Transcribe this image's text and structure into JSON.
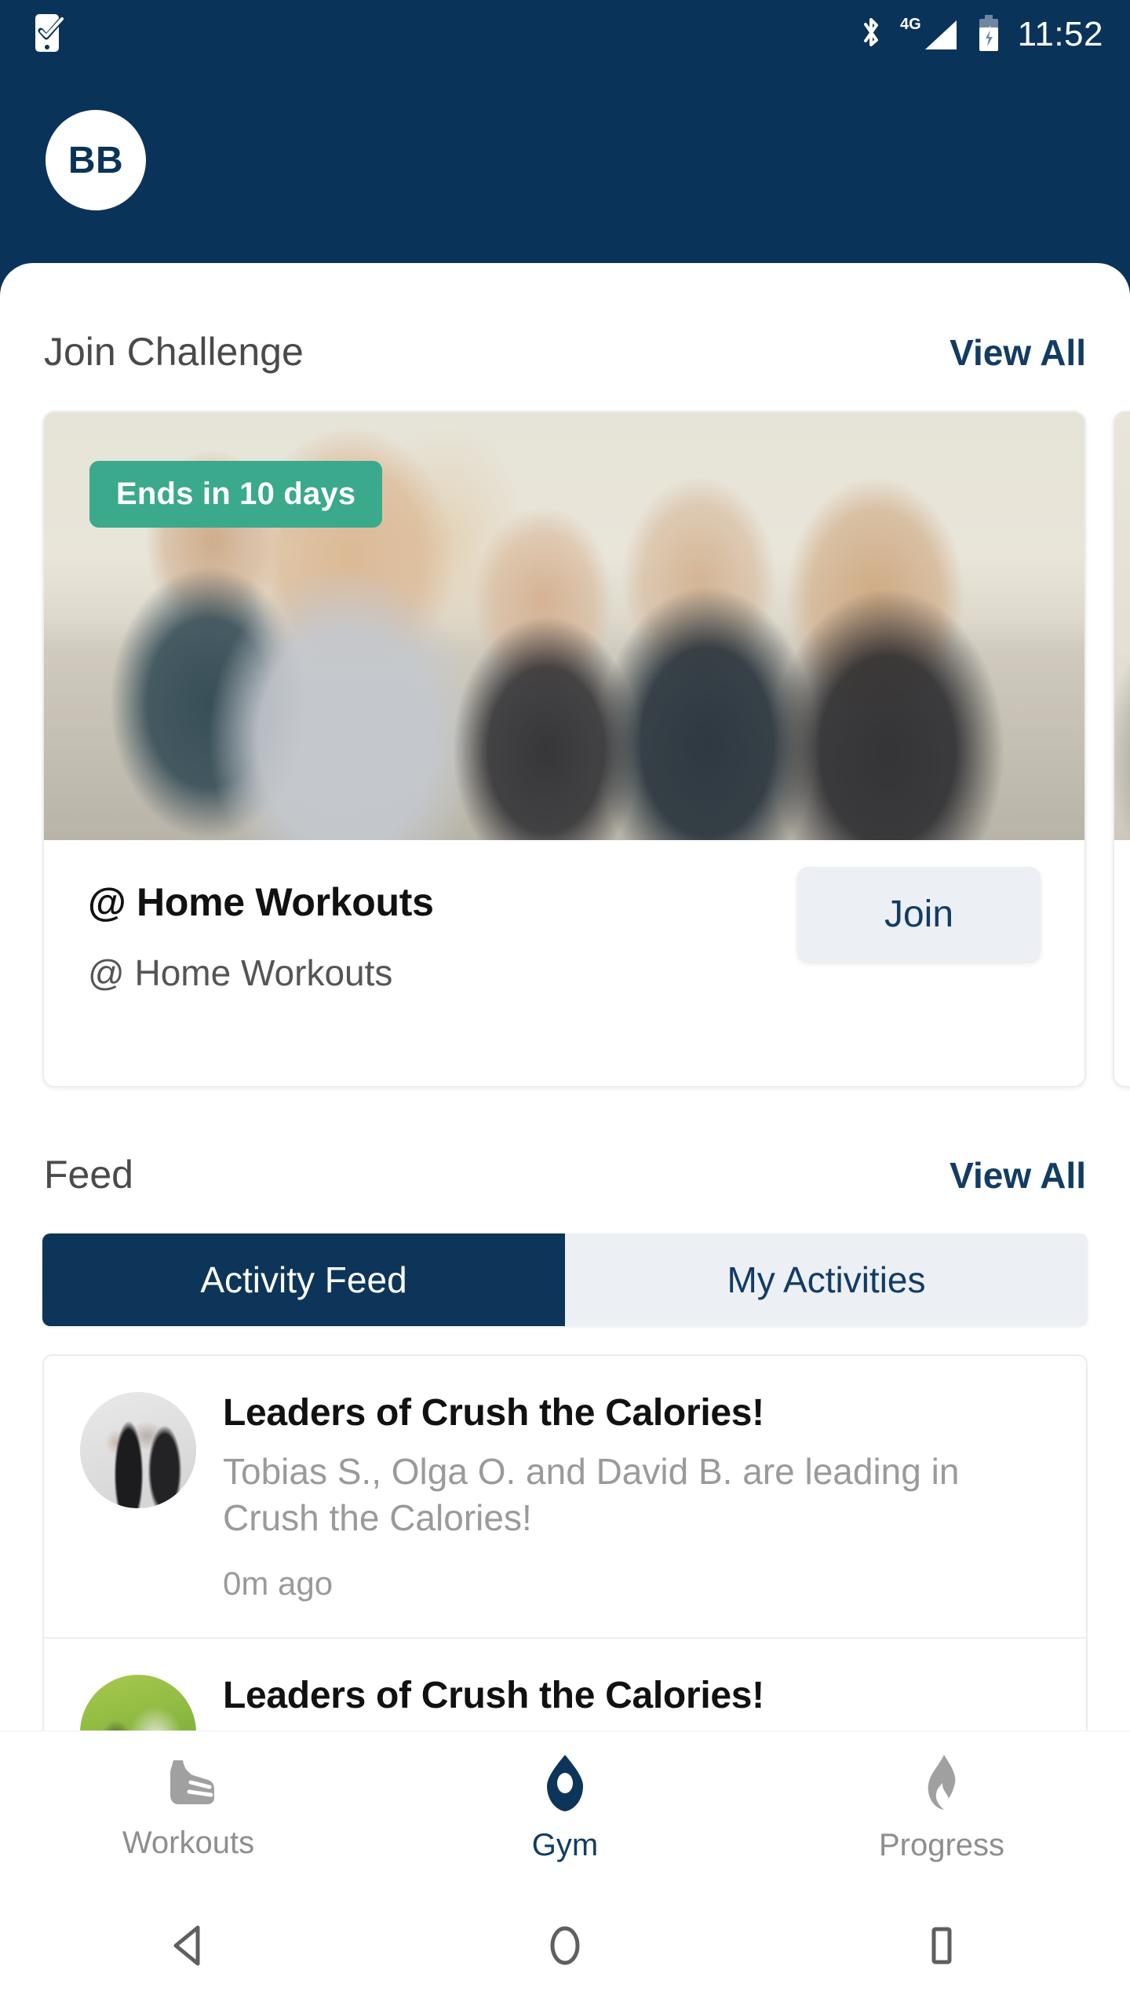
{
  "status_bar": {
    "notification_icon": "phone-check-icon",
    "bluetooth_icon": "bluetooth-icon",
    "network_label": "4G",
    "signal_icon": "signal-bars-icon",
    "battery_icon": "battery-charging-icon",
    "time": "11:52"
  },
  "header": {
    "avatar_initials": "BB",
    "background_color": "#0a3359"
  },
  "challenge_section": {
    "title": "Join Challenge",
    "view_all_label": "View All",
    "cards": [
      {
        "badge": "Ends in 10 days",
        "title": "@ Home Workouts",
        "subtitle": "@ Home Workouts",
        "action_label": "Join",
        "image_alt": "group of people running on the beach"
      },
      {
        "badge": "",
        "title": "",
        "subtitle": "",
        "action_label": "",
        "image_alt": "runner in white cap outdoors"
      }
    ]
  },
  "feed_section": {
    "title": "Feed",
    "view_all_label": "View All",
    "tabs": [
      {
        "label": "Activity Feed",
        "active": true
      },
      {
        "label": "My Activities",
        "active": false
      }
    ],
    "items": [
      {
        "title": "Leaders of Crush the Calories!",
        "body": "Tobias S., Olga O. and David B. are leading in Crush the Calories!",
        "time": "0m ago",
        "avatar_alt": "woman in yoga triangle pose"
      },
      {
        "title": "Leaders of Crush the Calories!",
        "body": "",
        "time": "",
        "avatar_alt": "people outdoors on grass"
      }
    ]
  },
  "bottom_nav": {
    "items": [
      {
        "label": "Workouts",
        "icon": "shoe-icon",
        "active": false
      },
      {
        "label": "Gym",
        "icon": "location-pin-icon",
        "active": true
      },
      {
        "label": "Progress",
        "icon": "flame-icon",
        "active": false
      }
    ]
  },
  "android_nav": {
    "back": "back-triangle-icon",
    "home": "home-circle-icon",
    "recents": "recents-square-icon"
  },
  "colors": {
    "navy": "#0a3359",
    "navy_text": "#123c63",
    "teal_badge": "#3ba98c",
    "light_blue_grey": "#eceff4",
    "muted_text": "#9a9a9a"
  }
}
